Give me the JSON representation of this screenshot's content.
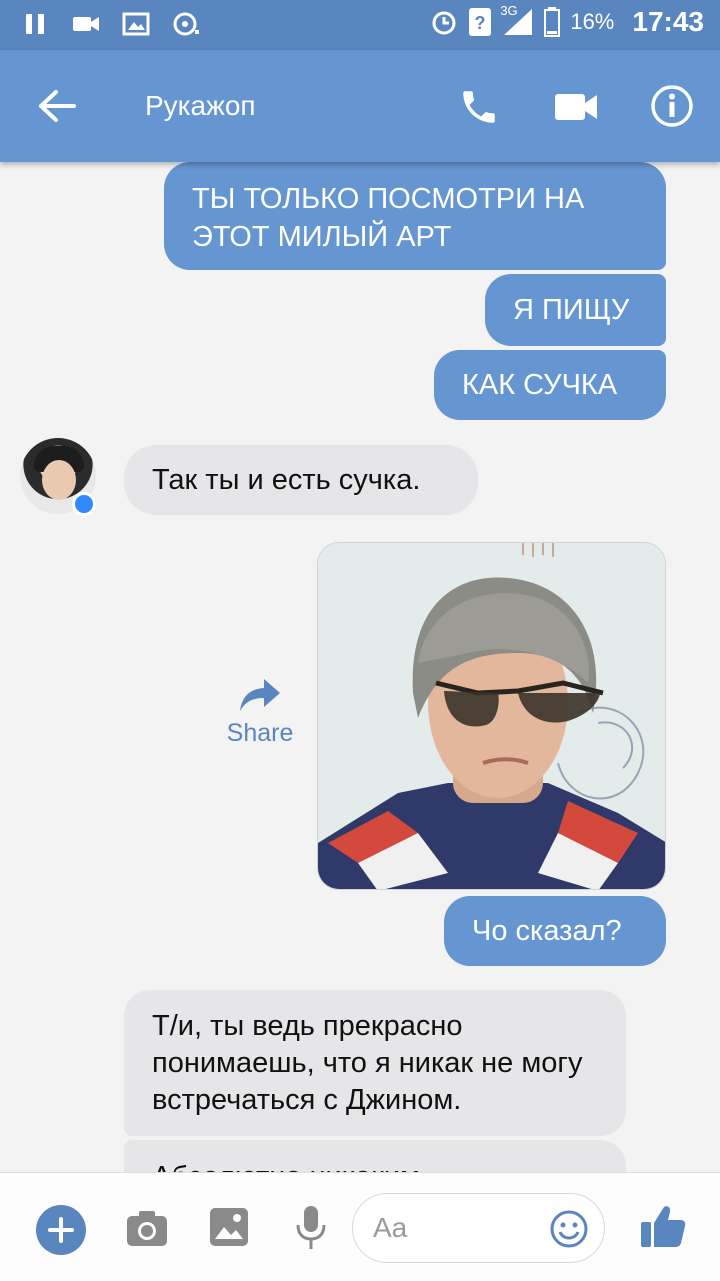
{
  "status_bar": {
    "battery_percent": "16%",
    "network": "3G",
    "time": "17:43"
  },
  "header": {
    "title": "Рукажоп"
  },
  "messages": [
    {
      "side": "out",
      "text": "ТЫ ТОЛЬКО ПОСМОТРИ НА ЭТОТ МИЛЫЙ АРТ"
    },
    {
      "side": "out",
      "text": "Я ПИЩУ"
    },
    {
      "side": "out",
      "text": "КАК СУЧКА"
    },
    {
      "side": "in",
      "text": "Так ты и есть сучка."
    },
    {
      "side": "out",
      "type": "image"
    },
    {
      "side": "out",
      "text": "Чо сказал?"
    },
    {
      "side": "in",
      "text": "Т/и, ты ведь прекрасно понимаешь, что я никак не могу встречаться с Джином."
    },
    {
      "side": "in",
      "text": "Абсолютно никаким"
    }
  ],
  "share": {
    "label": "Share"
  },
  "composer": {
    "placeholder": "Aa"
  },
  "colors": {
    "brand": "#6596d1",
    "status_bar": "#5a86bf",
    "incoming_bubble": "#e6e6e9"
  }
}
